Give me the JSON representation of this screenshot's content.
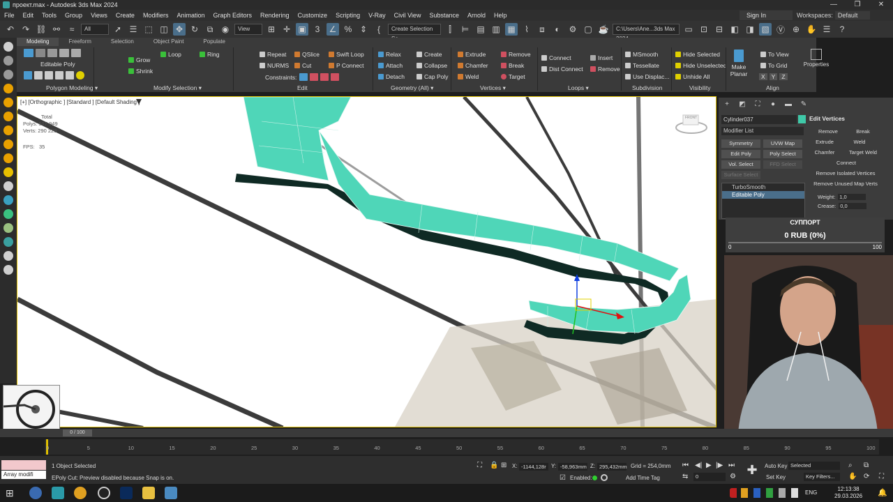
{
  "titlebar": {
    "title": "проект.max - Autodesk 3ds Max 2024",
    "minimize": "—",
    "restore": "❐",
    "close": "✕"
  },
  "menu": [
    "File",
    "Edit",
    "Tools",
    "Group",
    "Views",
    "Create",
    "Modifiers",
    "Animation",
    "Graph Editors",
    "Rendering",
    "Customize",
    "Scripting",
    "V-Ray",
    "Civil View",
    "Substance",
    "Arnold",
    "Help"
  ],
  "account": {
    "signin": "Sign In",
    "workspaces_label": "Workspaces:",
    "workspace": "Default"
  },
  "toolbar": {
    "selection_filter": "All",
    "ref_coord": "View",
    "named_selection": "Create Selection Se",
    "project_path": "C:\\Users\\Ane...3ds Max 2024"
  },
  "ribbon": {
    "tabs": [
      "Modeling",
      "Freeform",
      "Selection",
      "Object Paint",
      "Populate"
    ],
    "object_type": "Editable Poly",
    "tools": {
      "grow": "Grow",
      "shrink": "Shrink",
      "loop": "Loop",
      "ring": "Ring",
      "repeat": "Repeat",
      "qslice": "QSlice",
      "swift_loop": "Swift Loop",
      "nurms": "NURMS",
      "cut": "Cut",
      "p_connect": "P Connect",
      "constraints": "Constraints:",
      "relax": "Relax",
      "create": "Create",
      "attach": "Attach",
      "collapse": "Collapse",
      "detach": "Detach",
      "cap_poly": "Cap Poly",
      "extrude": "Extrude",
      "remove": "Remove",
      "chamfer": "Chamfer",
      "break": "Break",
      "weld": "Weld",
      "target": "Target",
      "connect": "Connect",
      "dist_connect": "Dist Connect",
      "insert": "Insert",
      "remove2": "Remove",
      "msmooth": "MSmooth",
      "tessellate": "Tessellate",
      "use_displac": "Use Displac...",
      "hide_selected": "Hide Selected",
      "hide_unselected": "Hide Unselected",
      "unhide_all": "Unhide All",
      "make_planar": "Make Planar",
      "to_view": "To View",
      "to_grid": "To Grid",
      "x": "X",
      "y": "Y",
      "z": "Z",
      "properties": "Properties"
    },
    "groups": [
      "Polygon Modeling ▾",
      "Modify Selection ▾",
      "Edit",
      "Geometry (All) ▾",
      "Vertices ▾",
      "Loops ▾",
      "Subdivision",
      "Visibility",
      "Align"
    ]
  },
  "viewport": {
    "label": "[+] [Orthographic ] [Standard ] [Default Shading ]",
    "total": "Total",
    "polys_label": "Polys:",
    "polys": "517 949",
    "verts_label": "Verts:",
    "verts": "290 229",
    "fps_label": "FPS:",
    "fps": "35",
    "viewcube_label": "FRONT"
  },
  "command_panel": {
    "object_name": "Cylinder037",
    "object_color": "#3fc9a8",
    "modifier_list": "Modifier List",
    "mod_buttons": [
      "Symmetry",
      "UVW Map",
      "Edit Poly",
      "Poly Select",
      "Vol. Select",
      "FFD Select",
      "Surface Select"
    ],
    "stack": [
      "TurboSmooth",
      "Editable Poly"
    ],
    "edit_vertices": {
      "title": "Edit Vertices",
      "remove": "Remove",
      "break": "Break",
      "extrude": "Extrude",
      "weld": "Weld",
      "chamfer": "Chamfer",
      "target_weld": "Target Weld",
      "connect": "Connect",
      "remove_isolated": "Remove Isolated Vertices",
      "remove_unused": "Remove Unused Map Verts",
      "weight_label": "Weight:",
      "weight": "1,0",
      "crease_label": "Crease:",
      "crease": "0,0"
    }
  },
  "support": {
    "title": "СУППОРТ",
    "amount": "0 RUB (0%)",
    "min": "0",
    "max": "100",
    "progress": 0
  },
  "timeline": {
    "slider": "0 / 100",
    "ticks": [
      "0",
      "5",
      "10",
      "15",
      "20",
      "25",
      "30",
      "35",
      "40",
      "45",
      "50",
      "55",
      "60",
      "65",
      "70",
      "75",
      "80",
      "85",
      "90",
      "95",
      "100"
    ]
  },
  "status": {
    "maxscript": "Array modifi",
    "selected": "1 Object Selected",
    "prompt": "EPoly Cut: Preview disabled because Snap is on.",
    "x_label": "X:",
    "x": "-1144,128r",
    "y_label": "Y:",
    "y": "-58,963mm",
    "z_label": "Z:",
    "z": "295,432mm",
    "grid": "Grid = 254,0mm",
    "enabled": "Enabled:",
    "add_time_tag": "Add Time Tag",
    "frame": "0",
    "auto_key": "Auto Key",
    "set_key": "Set Key",
    "key_mode": "Selected",
    "key_filters": "Key Filters..."
  },
  "taskbar": {
    "lang": "ENG",
    "time": "12:13:38",
    "date": "29.03.2026"
  }
}
